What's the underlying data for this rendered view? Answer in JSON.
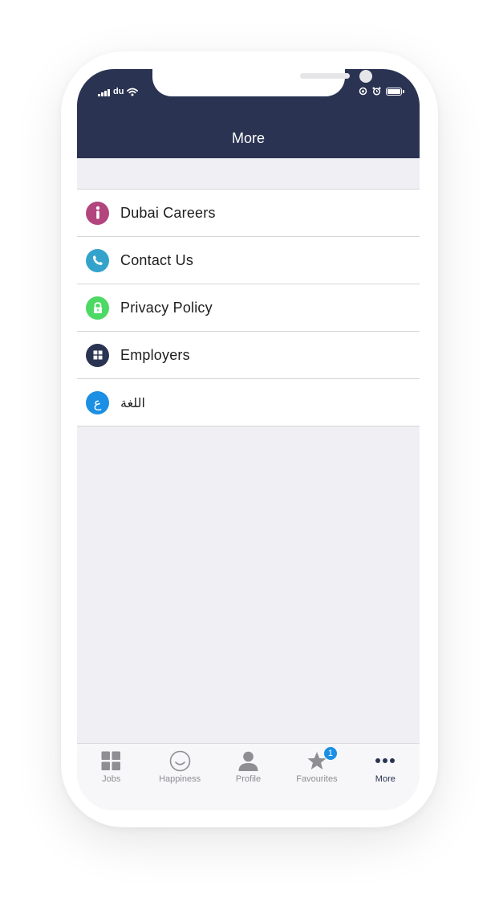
{
  "status_bar": {
    "carrier": "du"
  },
  "nav": {
    "title": "More"
  },
  "menu": {
    "items": [
      {
        "label": "Dubai Careers",
        "icon": "info-icon",
        "color": "#b3457e"
      },
      {
        "label": "Contact Us",
        "icon": "phone-icon",
        "color": "#33a3cc"
      },
      {
        "label": "Privacy Policy",
        "icon": "lock-icon",
        "color": "#4cd964"
      },
      {
        "label": "Employers",
        "icon": "grid-icon",
        "color": "#2a3352"
      },
      {
        "label": "اللغة",
        "icon": "arabic-letter-icon",
        "icon_text": "ع",
        "color": "#1a8fe3"
      }
    ]
  },
  "tabbar": {
    "tabs": [
      {
        "label": "Jobs",
        "icon": "grid-icon",
        "active": false
      },
      {
        "label": "Happiness",
        "icon": "smiley-icon",
        "active": false
      },
      {
        "label": "Profile",
        "icon": "person-icon",
        "active": false
      },
      {
        "label": "Favourites",
        "icon": "star-icon",
        "active": false,
        "badge": "1"
      },
      {
        "label": "More",
        "icon": "more-dots-icon",
        "active": true
      }
    ]
  },
  "colors": {
    "header": "#2a3352",
    "background": "#efeff4",
    "badge": "#1a8fe3"
  }
}
